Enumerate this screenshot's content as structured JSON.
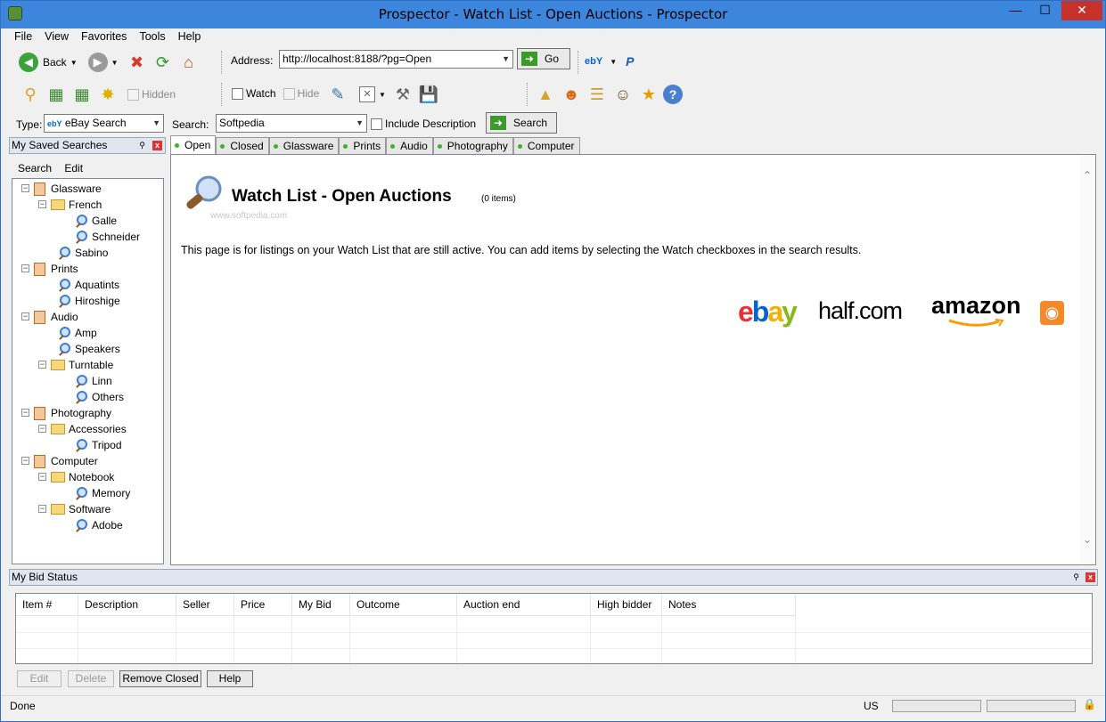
{
  "window": {
    "title": "Prospector - Watch List - Open Auctions - Prospector"
  },
  "menu": [
    "File",
    "View",
    "Favorites",
    "Tools",
    "Help"
  ],
  "toolbar": {
    "back_label": "Back",
    "address_label": "Address:",
    "address_value": "http://localhost:8188/?pg=Open",
    "go_label": "Go",
    "ebay_mini": "ebY",
    "hidden_label": "Hidden",
    "watch_label": "Watch",
    "hide_label": "Hide",
    "type_label": "Type:",
    "type_value": "eBay Search",
    "type_prefix": "ebY",
    "search_label": "Search:",
    "search_value": "Softpedia",
    "include_desc_label": "Include Description",
    "search_button": "Search"
  },
  "saved_searches": {
    "title": "My Saved Searches",
    "menu": [
      "Search",
      "Edit"
    ],
    "tree": [
      {
        "label": "Glassware",
        "type": "book",
        "level": 0,
        "exp": "−"
      },
      {
        "label": "French",
        "type": "folder",
        "level": 1,
        "exp": "−"
      },
      {
        "label": "Galle",
        "type": "search",
        "level": 2
      },
      {
        "label": "Schneider",
        "type": "search",
        "level": 2
      },
      {
        "label": "Sabino",
        "type": "search",
        "level": 1
      },
      {
        "label": "Prints",
        "type": "book",
        "level": 0,
        "exp": "−"
      },
      {
        "label": "Aquatints",
        "type": "search",
        "level": 1
      },
      {
        "label": "Hiroshige",
        "type": "search",
        "level": 1
      },
      {
        "label": "Audio",
        "type": "book",
        "level": 0,
        "exp": "−"
      },
      {
        "label": "Amp",
        "type": "search",
        "level": 1
      },
      {
        "label": "Speakers",
        "type": "search",
        "level": 1
      },
      {
        "label": "Turntable",
        "type": "folder",
        "level": 1,
        "exp": "−"
      },
      {
        "label": "Linn",
        "type": "search",
        "level": 2
      },
      {
        "label": "Others",
        "type": "search",
        "level": 2
      },
      {
        "label": "Photography",
        "type": "book",
        "level": 0,
        "exp": "−"
      },
      {
        "label": "Accessories",
        "type": "folder",
        "level": 1,
        "exp": "−"
      },
      {
        "label": "Tripod",
        "type": "search",
        "level": 2
      },
      {
        "label": "Computer",
        "type": "book",
        "level": 0,
        "exp": "−"
      },
      {
        "label": "Notebook",
        "type": "folder",
        "level": 1,
        "exp": "−"
      },
      {
        "label": "Memory",
        "type": "search",
        "level": 2
      },
      {
        "label": "Software",
        "type": "folder",
        "level": 1,
        "exp": "−"
      },
      {
        "label": "Adobe",
        "type": "search",
        "level": 2
      }
    ]
  },
  "tabs": [
    {
      "label": "Open",
      "active": true
    },
    {
      "label": "Closed"
    },
    {
      "label": "Glassware"
    },
    {
      "label": "Prints"
    },
    {
      "label": "Audio"
    },
    {
      "label": "Photography"
    },
    {
      "label": "Computer"
    }
  ],
  "page": {
    "title": "Watch List - Open Auctions",
    "count": "(0 items)",
    "watermark": "www.softpedia.com",
    "description": "This page is for listings on your Watch List that are still active. You can add items by selecting the Watch checkboxes in the search results.",
    "logos": [
      "ebay",
      "half.com",
      "amazon"
    ]
  },
  "bid_status": {
    "title": "My Bid Status",
    "columns": [
      "Item #",
      "Description",
      "Seller",
      "Price",
      "My Bid",
      "Outcome",
      "Auction end",
      "High bidder",
      "Notes"
    ],
    "buttons": [
      {
        "label": "Edit",
        "enabled": false
      },
      {
        "label": "Delete",
        "enabled": false
      },
      {
        "label": "Remove Closed",
        "enabled": true
      },
      {
        "label": "Help",
        "enabled": true
      }
    ]
  },
  "status": {
    "text": "Done",
    "locale": "US"
  },
  "colors": {
    "title_bar": "#3d86de",
    "tab_dot": "#3bb32c",
    "ebay_red": "#e53238",
    "ebay_blue": "#0064d2",
    "ebay_yellow": "#f5af02",
    "ebay_green": "#86b817",
    "amazon_orange": "#ff9900"
  }
}
